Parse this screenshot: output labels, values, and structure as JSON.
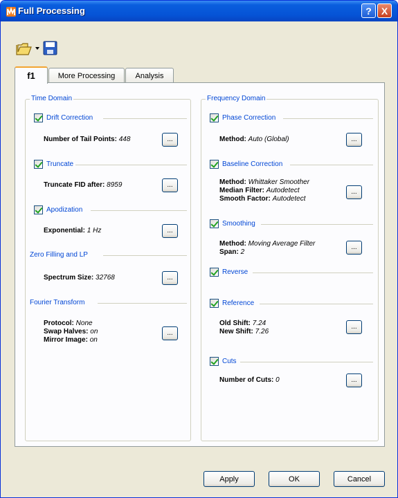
{
  "window": {
    "title": "Full Processing"
  },
  "tabs": [
    {
      "label": "f1"
    },
    {
      "label": "More Processing"
    },
    {
      "label": "Analysis"
    }
  ],
  "time_domain": {
    "title": "Time Domain",
    "drift": {
      "label": "Drift Correction",
      "k": "Number of Tail Points:",
      "v": "448"
    },
    "truncate": {
      "label": "Truncate",
      "k": "Truncate FID after:",
      "v": "8959"
    },
    "apod": {
      "label": "Apodization",
      "k": "Exponential:",
      "v": "1 Hz"
    },
    "zerofill": {
      "label": "Zero Filling and LP",
      "k": "Spectrum Size:",
      "v": "32768"
    },
    "fourier": {
      "label": "Fourier Transform",
      "rows": [
        {
          "k": "Protocol:",
          "v": "None"
        },
        {
          "k": "Swap Halves:",
          "v": "on"
        },
        {
          "k": "Mirror Image:",
          "v": "on"
        }
      ]
    }
  },
  "freq_domain": {
    "title": "Frequency Domain",
    "phase": {
      "label": "Phase Correction",
      "k": "Method:",
      "v": "Auto (Global)"
    },
    "baseline": {
      "label": "Baseline Correction",
      "rows": [
        {
          "k": "Method:",
          "v": "Whittaker Smoother"
        },
        {
          "k": "Median Filter:",
          "v": "Autodetect"
        },
        {
          "k": "Smooth Factor:",
          "v": "Autodetect"
        }
      ]
    },
    "smoothing": {
      "label": "Smoothing",
      "rows": [
        {
          "k": "Method:",
          "v": "Moving Average Filter"
        },
        {
          "k": "Span:",
          "v": "2"
        }
      ]
    },
    "reverse": {
      "label": "Reverse"
    },
    "reference": {
      "label": "Reference",
      "rows": [
        {
          "k": "Old Shift:",
          "v": "7.24"
        },
        {
          "k": "New Shift:",
          "v": "7.26"
        }
      ]
    },
    "cuts": {
      "label": "Cuts",
      "k": "Number of Cuts:",
      "v": "0"
    }
  },
  "ellipsis": "...",
  "buttons": {
    "apply": "Apply",
    "ok": "OK",
    "cancel": "Cancel"
  },
  "title_buttons": {
    "help": "?",
    "close": "X"
  }
}
